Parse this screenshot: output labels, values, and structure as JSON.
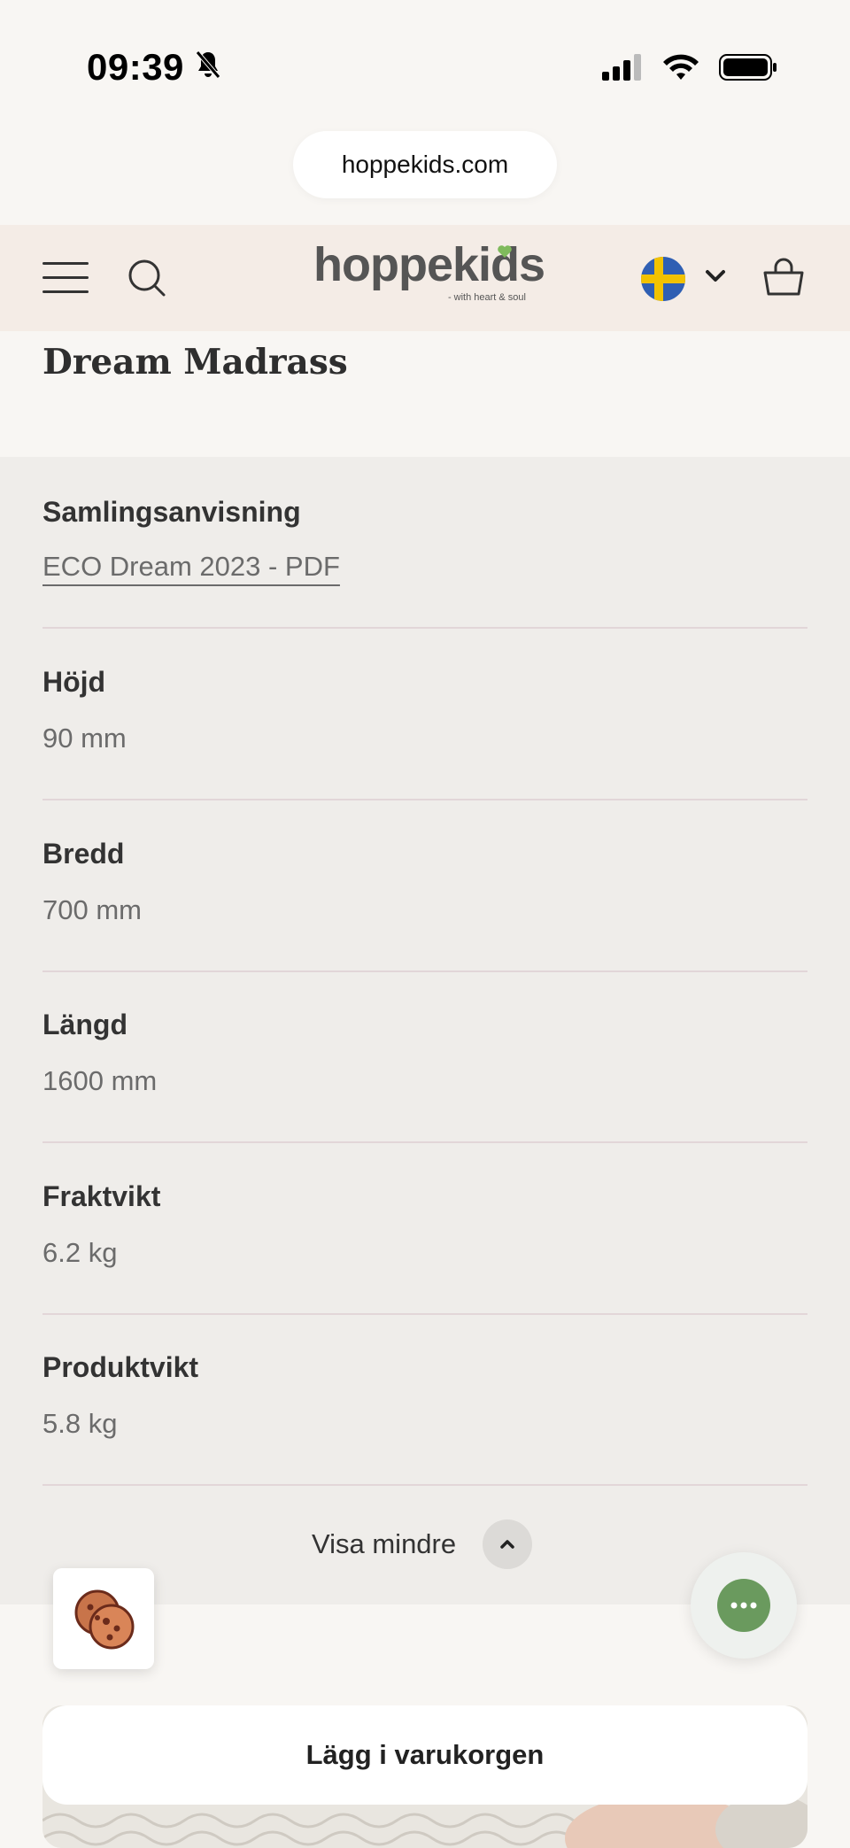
{
  "status_bar": {
    "time": "09:39"
  },
  "browser": {
    "url": "hoppekids.com"
  },
  "header": {
    "logo_text": "hoppekids",
    "logo_tagline": "- with heart & soul",
    "country_flag": "Sweden",
    "icons": [
      "menu-icon",
      "search-icon",
      "chevron-down-icon",
      "cart-icon"
    ]
  },
  "product": {
    "title_visible": "Dream Madrass"
  },
  "specs": {
    "items": [
      {
        "label": "Samlingsanvisning",
        "value": "ECO Dream 2023  -  PDF",
        "is_link": true
      },
      {
        "label": "Höjd",
        "value": "90 mm"
      },
      {
        "label": "Bredd",
        "value": "700 mm"
      },
      {
        "label": "Längd",
        "value": "1600 mm"
      },
      {
        "label": "Fraktvikt",
        "value": "6.2 kg"
      },
      {
        "label": "Produktvikt",
        "value": "5.8 kg"
      }
    ],
    "toggle_label": "Visa mindre"
  },
  "actions": {
    "add_to_cart": "Lägg i varukorgen"
  },
  "colors": {
    "page_bg": "#f8f6f3",
    "header_bg": "#f4ece6",
    "specs_bg": "#efedea",
    "chat_green": "#6a9a5e"
  }
}
